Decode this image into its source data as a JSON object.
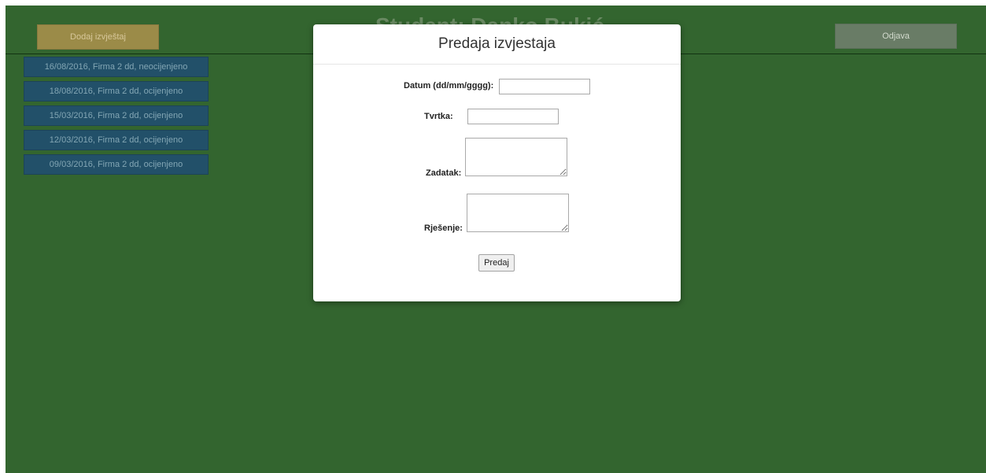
{
  "header": {
    "add_report_label": "Dodaj izvještaj",
    "title": "Student: Danko Bukić",
    "logout_label": "Odjava"
  },
  "reports": [
    {
      "label": "16/08/2016, Firma 2 dd, neocijenjeno"
    },
    {
      "label": "18/08/2016, Firma 2 dd, ocijenjeno"
    },
    {
      "label": "15/03/2016, Firma 2 dd, ocijenjeno"
    },
    {
      "label": "12/03/2016, Firma 2 dd, ocijenjeno"
    },
    {
      "label": "09/03/2016, Firma 2 dd, ocijenjeno"
    }
  ],
  "modal": {
    "title": "Predaja izvjestaja",
    "date_label": "Datum (dd/mm/gggg):",
    "date_value": "",
    "company_label": "Tvrtka:",
    "company_value": "",
    "task_label": "Zadatak:",
    "solution_label": "Rješenje:",
    "submit_label": "Predaj"
  },
  "colors": {
    "background": "#33652f",
    "add_button": "#9b8b48",
    "logout_button": "#697c66",
    "report_item": "#225069"
  }
}
